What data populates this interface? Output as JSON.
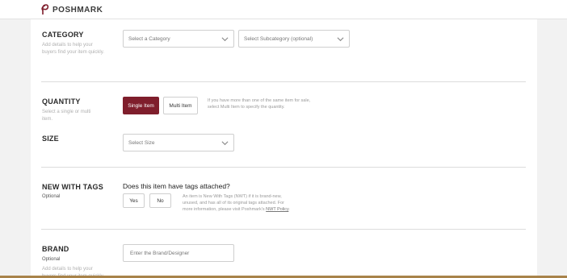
{
  "brand": {
    "name": "POSHMARK"
  },
  "category": {
    "title": "CATEGORY",
    "description": "Add details to help your buyers find your item quickly.",
    "select_placeholder": "Select a Category",
    "subcategory_placeholder": "Select Subcategory (optional)"
  },
  "quantity": {
    "title": "QUANTITY",
    "description": "Select a single or multi item.",
    "single_label": "Single Item",
    "multi_label": "Multi Item",
    "help": "If you have more than one of the same item for sale, select Multi Item to specify the quantity."
  },
  "size": {
    "title": "SIZE",
    "select_placeholder": "Select Size"
  },
  "nwt": {
    "title": "NEW WITH TAGS",
    "optional": "Optional",
    "question": "Does this item have tags attached?",
    "yes_label": "Yes",
    "no_label": "No",
    "help": "An item is New With Tags (NWT) if it is brand-new, unused, and has all of its original tags attached. For more information, please visit Poshmark's",
    "policy_link": "NWT Policy",
    "help_end": "."
  },
  "brand_section": {
    "title": "BRAND",
    "optional": "Optional",
    "description": "Add details to help your buyers find your item quickly.",
    "input_placeholder": "Enter the Brand/Designer"
  },
  "colors": {
    "accent": "#7f1e2c"
  }
}
